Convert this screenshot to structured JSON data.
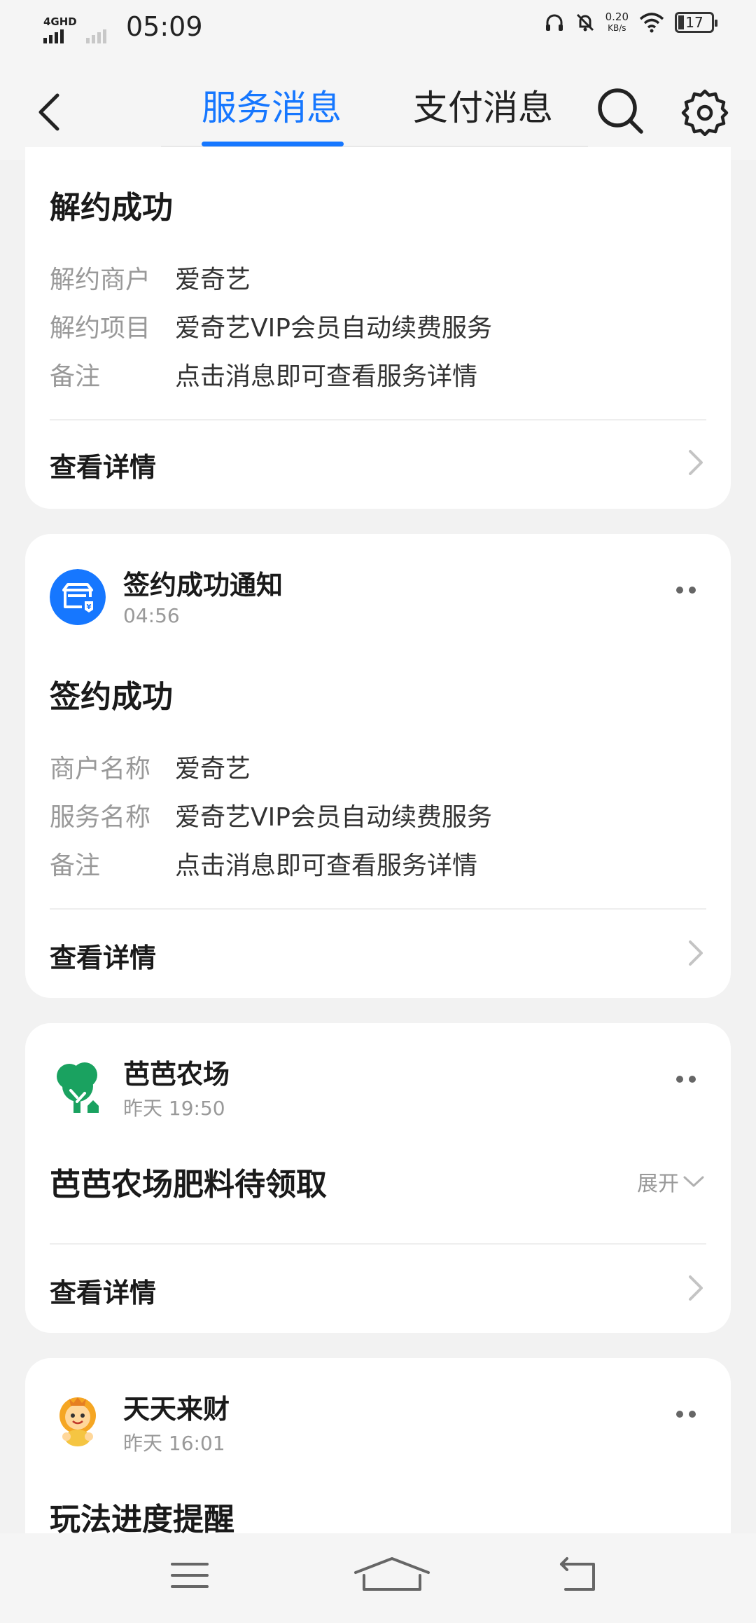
{
  "status_bar": {
    "network": "4GHD",
    "time": "05:09",
    "speed_value": "0.20",
    "speed_unit": "KB/s",
    "battery": "17"
  },
  "header": {
    "tabs": [
      {
        "label": "服务消息",
        "active": true
      },
      {
        "label": "支付消息",
        "active": false
      }
    ],
    "accent_color": "#1677ff"
  },
  "cards": [
    {
      "title": "解约成功",
      "fields": [
        {
          "label": "解约商户",
          "value": "爱奇艺"
        },
        {
          "label": "解约项目",
          "value": "爱奇艺VIP会员自动续费服务"
        },
        {
          "label": "备注",
          "value": "点击消息即可查看服务详情"
        }
      ],
      "link": "查看详情"
    },
    {
      "app_name": "签约成功通知",
      "time": "04:56",
      "icon": "store-icon",
      "title": "签约成功",
      "fields": [
        {
          "label": "商户名称",
          "value": "爱奇艺"
        },
        {
          "label": "服务名称",
          "value": "爱奇艺VIP会员自动续费服务"
        },
        {
          "label": "备注",
          "value": "点击消息即可查看服务详情"
        }
      ],
      "link": "查看详情"
    },
    {
      "app_name": "芭芭农场",
      "time": "昨天 19:50",
      "icon": "tree-icon",
      "title": "芭芭农场肥料待领取",
      "expand": "展开",
      "link": "查看详情"
    },
    {
      "app_name": "天天来财",
      "time": "昨天 16:01",
      "icon": "mascot-icon",
      "title": "玩法进度提醒"
    }
  ]
}
